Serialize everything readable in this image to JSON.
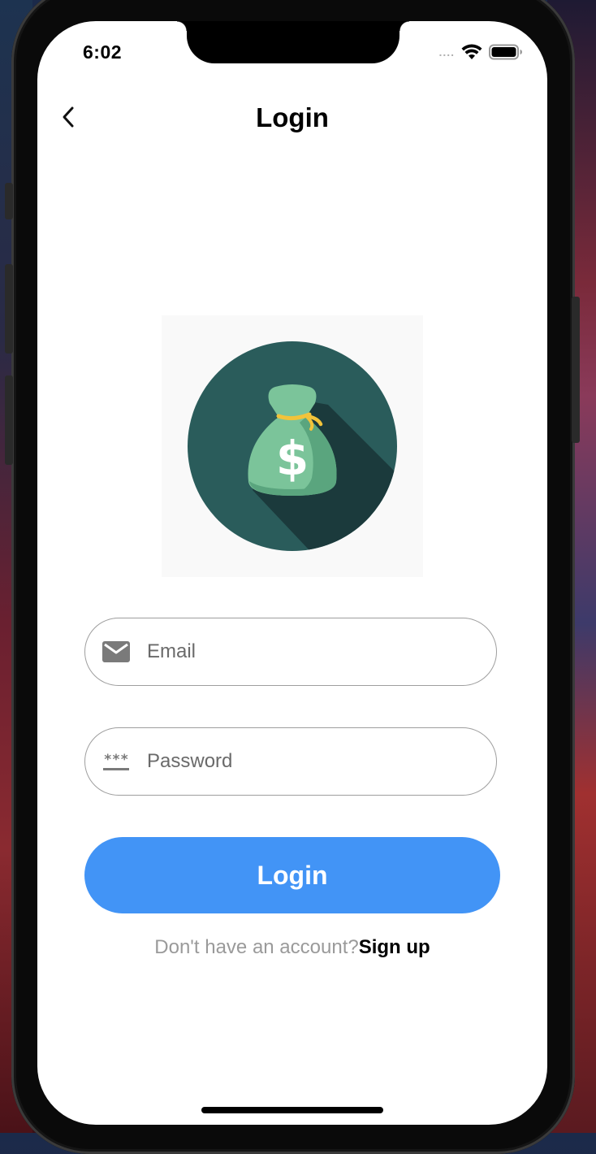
{
  "status_bar": {
    "time": "6:02",
    "signal": "....",
    "wifi_icon": "wifi-icon",
    "battery_icon": "battery-icon"
  },
  "nav": {
    "back_icon": "chevron-left-icon",
    "title": "Login"
  },
  "logo": {
    "icon": "money-bag-icon",
    "symbol": "$",
    "colors": {
      "circle": "#2a5c5b",
      "shadow": "#1b3a3c",
      "bag": "#7bc49a",
      "bag_dark": "#5aa57e",
      "tie": "#f2c33a",
      "background": "#f9f9f9"
    }
  },
  "form": {
    "email": {
      "icon": "mail-icon",
      "placeholder": "Email",
      "value": ""
    },
    "password": {
      "icon": "password-icon",
      "icon_text": "***",
      "placeholder": "Password",
      "value": ""
    },
    "submit_label": "Login",
    "submit_color": "#4294f6"
  },
  "footer": {
    "prompt": "Don't have an account?",
    "link": "Sign up"
  }
}
